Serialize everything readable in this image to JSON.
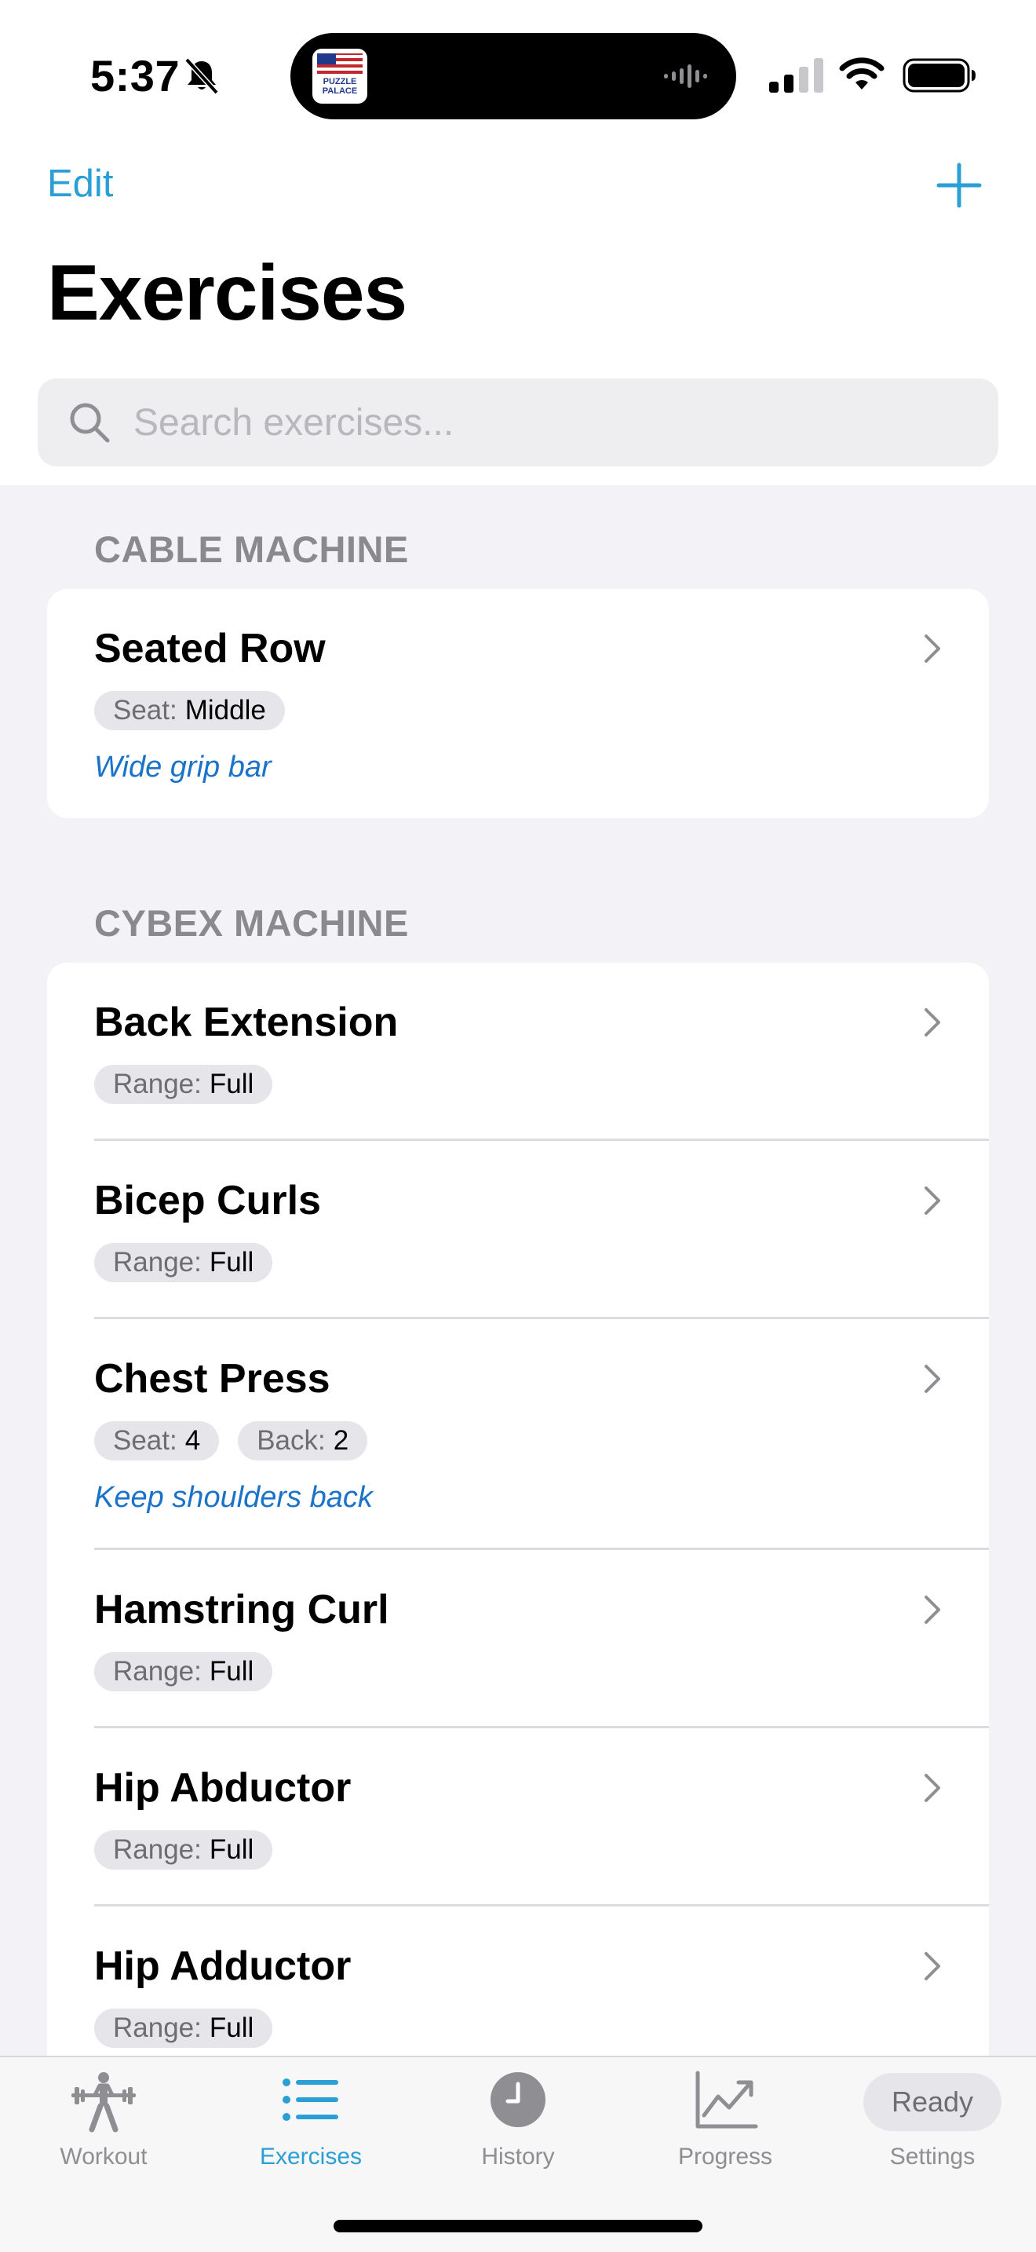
{
  "status": {
    "time": "5:37"
  },
  "island": {
    "app_text": "PUZZLE PALACE"
  },
  "nav": {
    "edit_label": "Edit",
    "title": "Exercises"
  },
  "search": {
    "placeholder": "Search exercises..."
  },
  "sections": [
    {
      "header": "CABLE MACHINE",
      "items": [
        {
          "name": "Seated Row",
          "tags": [
            {
              "key": "Seat:",
              "value": "Middle"
            }
          ],
          "note": "Wide grip bar"
        }
      ]
    },
    {
      "header": "CYBEX MACHINE",
      "items": [
        {
          "name": "Back Extension",
          "tags": [
            {
              "key": "Range:",
              "value": "Full"
            }
          ]
        },
        {
          "name": "Bicep Curls",
          "tags": [
            {
              "key": "Range:",
              "value": "Full"
            }
          ]
        },
        {
          "name": "Chest Press",
          "tags": [
            {
              "key": "Seat:",
              "value": "4"
            },
            {
              "key": "Back:",
              "value": "2"
            }
          ],
          "note": "Keep shoulders back"
        },
        {
          "name": "Hamstring Curl",
          "tags": [
            {
              "key": "Range:",
              "value": "Full"
            }
          ]
        },
        {
          "name": "Hip Abductor",
          "tags": [
            {
              "key": "Range:",
              "value": "Full"
            }
          ]
        },
        {
          "name": "Hip Adductor",
          "tags": [
            {
              "key": "Range:",
              "value": "Full"
            }
          ]
        }
      ]
    }
  ],
  "tabs": [
    {
      "label": "Workout",
      "icon": "weightlifter-icon",
      "active": false
    },
    {
      "label": "Exercises",
      "icon": "list-icon",
      "active": true
    },
    {
      "label": "History",
      "icon": "clock-icon",
      "active": false
    },
    {
      "label": "Progress",
      "icon": "chart-icon",
      "active": false
    },
    {
      "label": "Settings",
      "icon": "gear-icon",
      "active": false,
      "overlay": "Ready"
    }
  ],
  "colors": {
    "accent": "#2a9fd6",
    "note": "#1a73c9",
    "background": "#f2f2f7"
  }
}
